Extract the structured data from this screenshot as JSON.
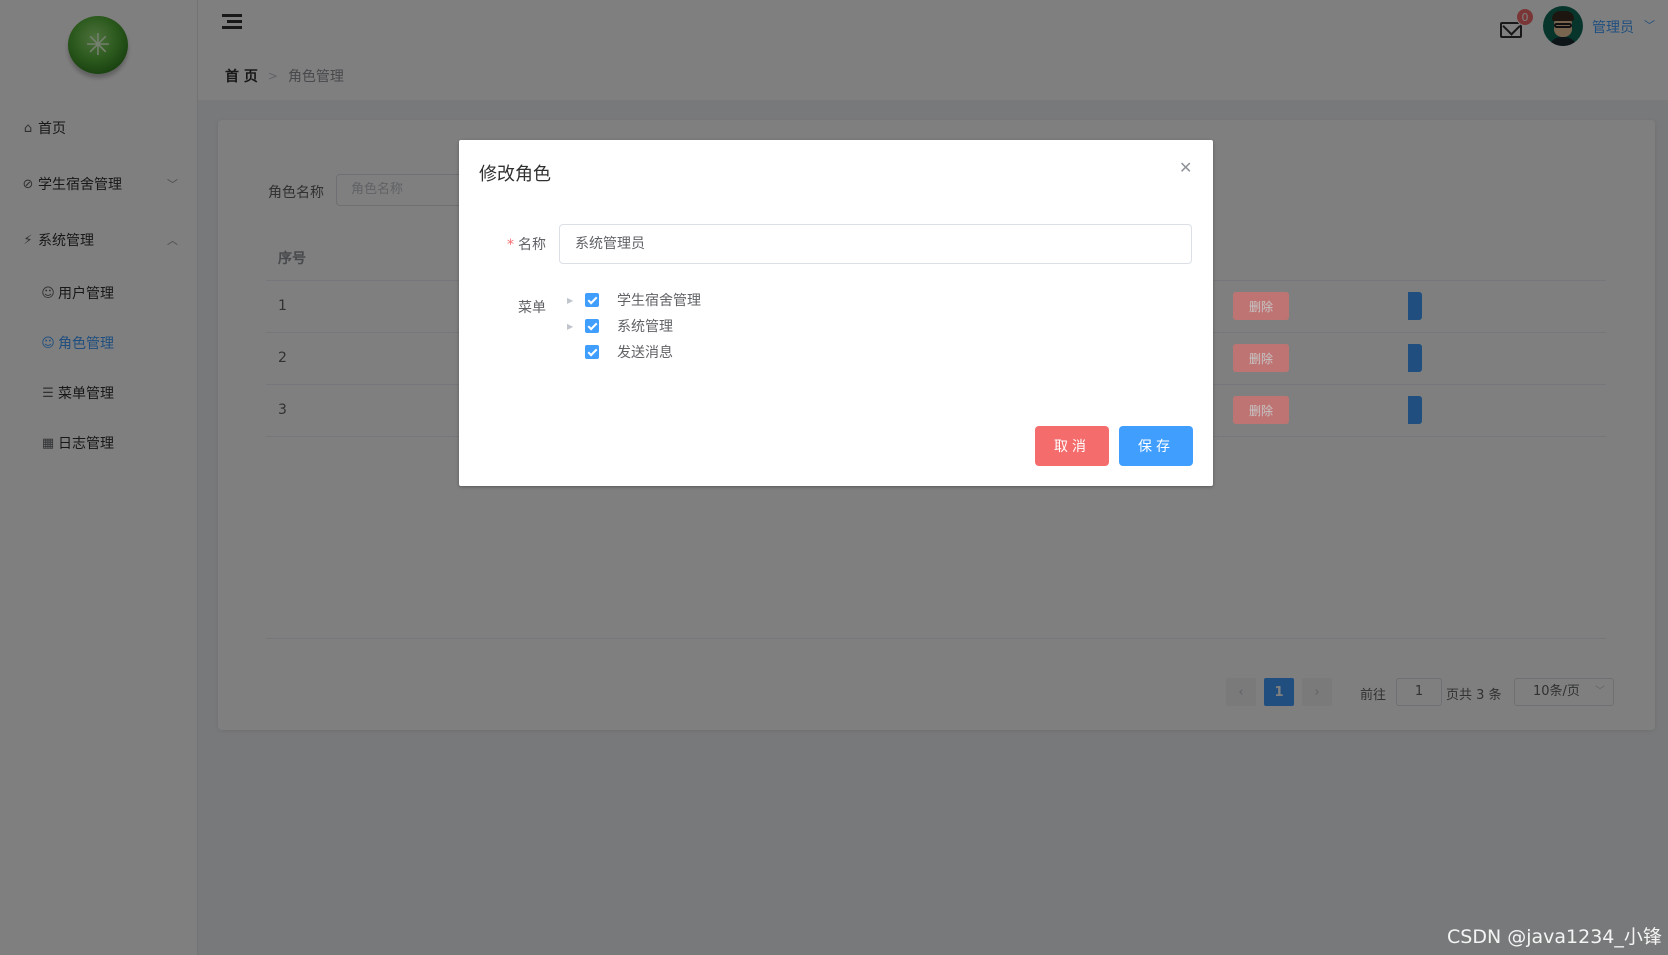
{
  "sidebar": {
    "items": [
      {
        "label": "首页",
        "icon": "home-icon"
      },
      {
        "label": "学生宿舍管理",
        "icon": "paperclip-icon"
      },
      {
        "label": "系统管理",
        "icon": "lightning-icon"
      },
      {
        "label": "用户管理",
        "icon": "user-icon"
      },
      {
        "label": "角色管理",
        "icon": "role-icon"
      },
      {
        "label": "菜单管理",
        "icon": "list-icon"
      },
      {
        "label": "日志管理",
        "icon": "table-icon"
      }
    ]
  },
  "header": {
    "breadcrumb_home": "首 页",
    "breadcrumb_current": "角色管理",
    "message_badge": "0",
    "user_name": "管理员"
  },
  "main": {
    "search_label": "角色名称",
    "search_placeholder": "角色名称",
    "column_index": "序号",
    "rows": [
      {
        "index": "1",
        "delete_label": "删除"
      },
      {
        "index": "2",
        "delete_label": "删除"
      },
      {
        "index": "3",
        "delete_label": "删除"
      }
    ],
    "pagination": {
      "current_page": "1",
      "goto_label": "前往",
      "goto_value": "1",
      "total_label": "页共 3 条",
      "page_size": "10条/页"
    }
  },
  "dialog": {
    "title": "修改角色",
    "name_label": "名称",
    "name_value": "系统管理员",
    "menu_label": "菜单",
    "tree": [
      {
        "label": "学生宿舍管理",
        "checked": true,
        "expandable": true
      },
      {
        "label": "系统管理",
        "checked": true,
        "expandable": true
      },
      {
        "label": "发送消息",
        "checked": true,
        "expandable": false
      }
    ],
    "cancel_label": "取消",
    "save_label": "保存"
  },
  "watermark": "CSDN @java1234_小锋",
  "colors": {
    "primary": "#409eff",
    "danger": "#f56c6c",
    "overlay": "rgba(0,0,0,0.5)"
  }
}
